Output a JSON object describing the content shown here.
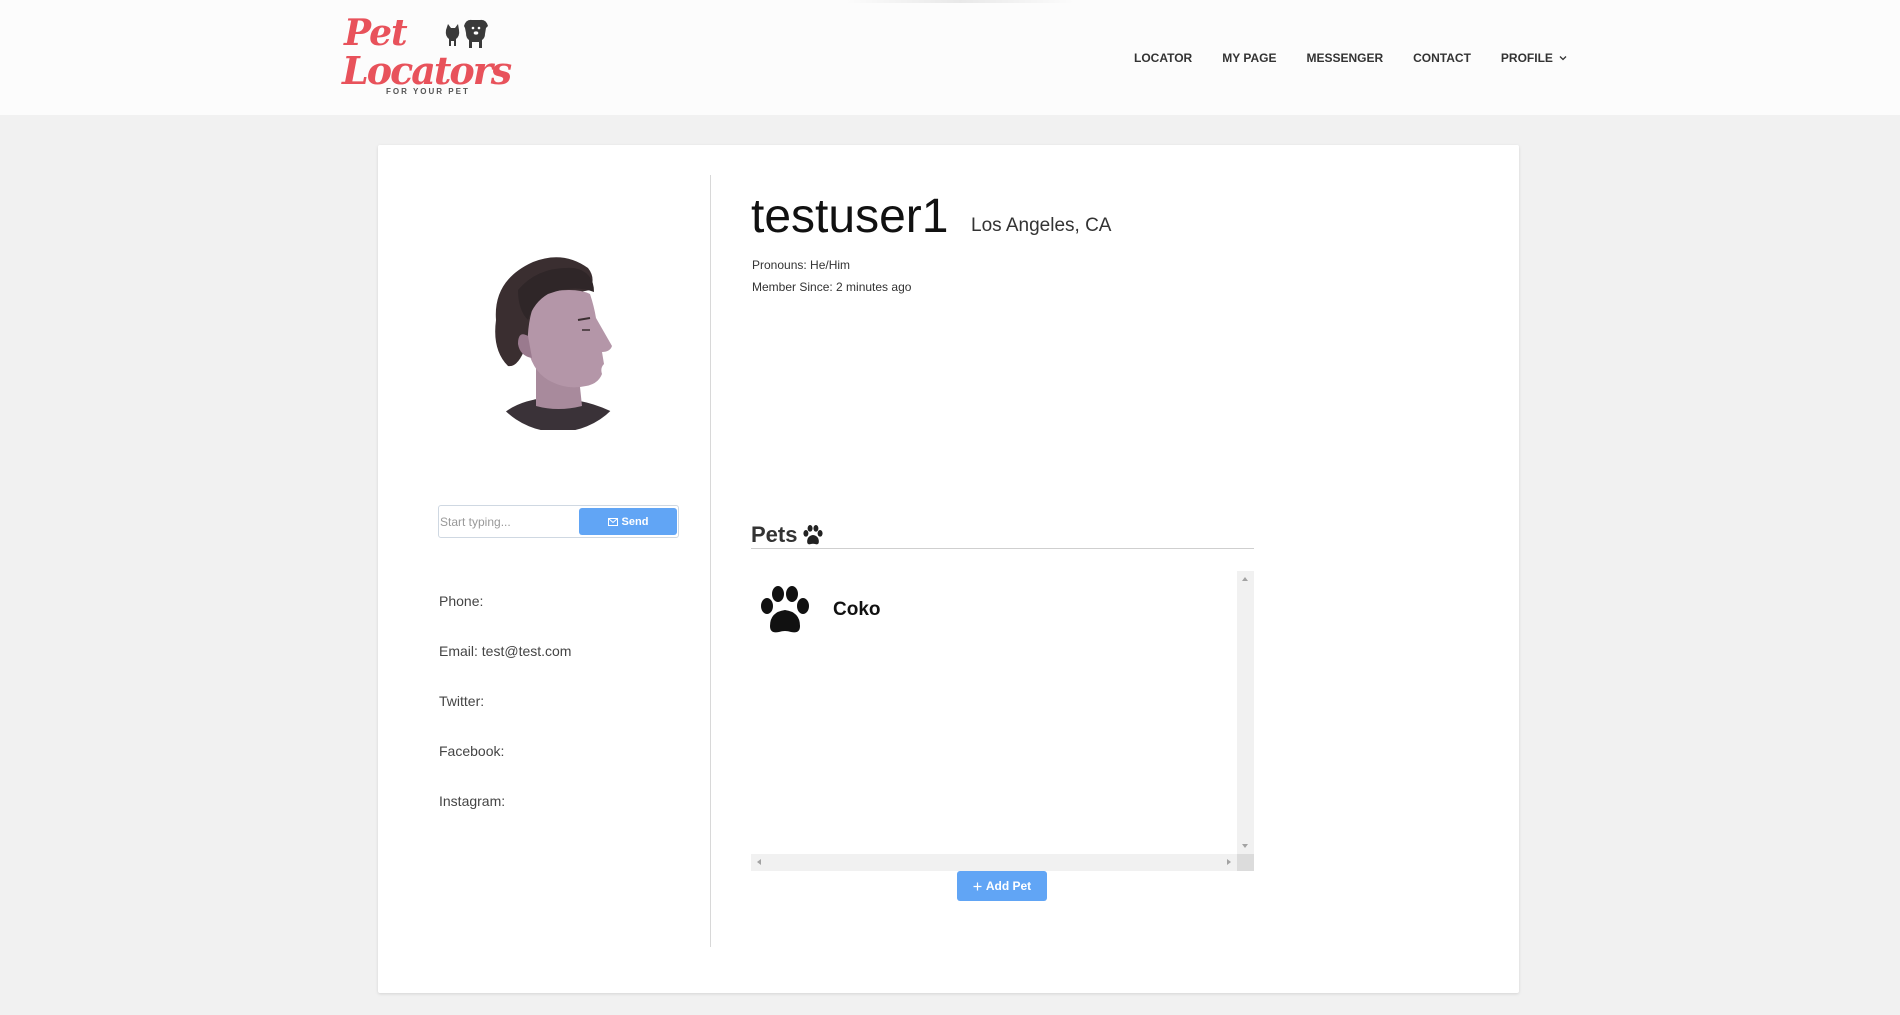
{
  "brand": {
    "line1": "Pet",
    "line2": "Locators",
    "tagline": "FOR YOUR PET"
  },
  "nav": {
    "items": [
      {
        "label": "LOCATOR"
      },
      {
        "label": "MY PAGE"
      },
      {
        "label": "MESSENGER"
      },
      {
        "label": "CONTACT"
      },
      {
        "label": "PROFILE"
      }
    ]
  },
  "profile": {
    "username": "testuser1",
    "location": "Los Angeles, CA",
    "pronouns": "Pronouns: He/Him",
    "member_since": "Member Since: 2 minutes ago"
  },
  "message": {
    "placeholder": "Start typing...",
    "send_label": "Send"
  },
  "contact": {
    "phone": "Phone:",
    "email": "Email: test@test.com",
    "twitter": "Twitter:",
    "facebook": "Facebook:",
    "instagram": "Instagram:"
  },
  "pets": {
    "heading": "Pets",
    "items": [
      {
        "name": "Coko"
      }
    ],
    "add_label": "Add Pet"
  },
  "colors": {
    "brand_red": "#e8525b",
    "accent_blue": "#61a5f5",
    "page_bg": "#f1f1f1"
  },
  "icons": {
    "logo_art": "cat-and-dog-icon",
    "pets_heading": "paw-icon",
    "pet_item": "paw-icon",
    "send": "mail-icon",
    "add": "plus-icon",
    "profile_menu": "chevron-down-icon"
  }
}
